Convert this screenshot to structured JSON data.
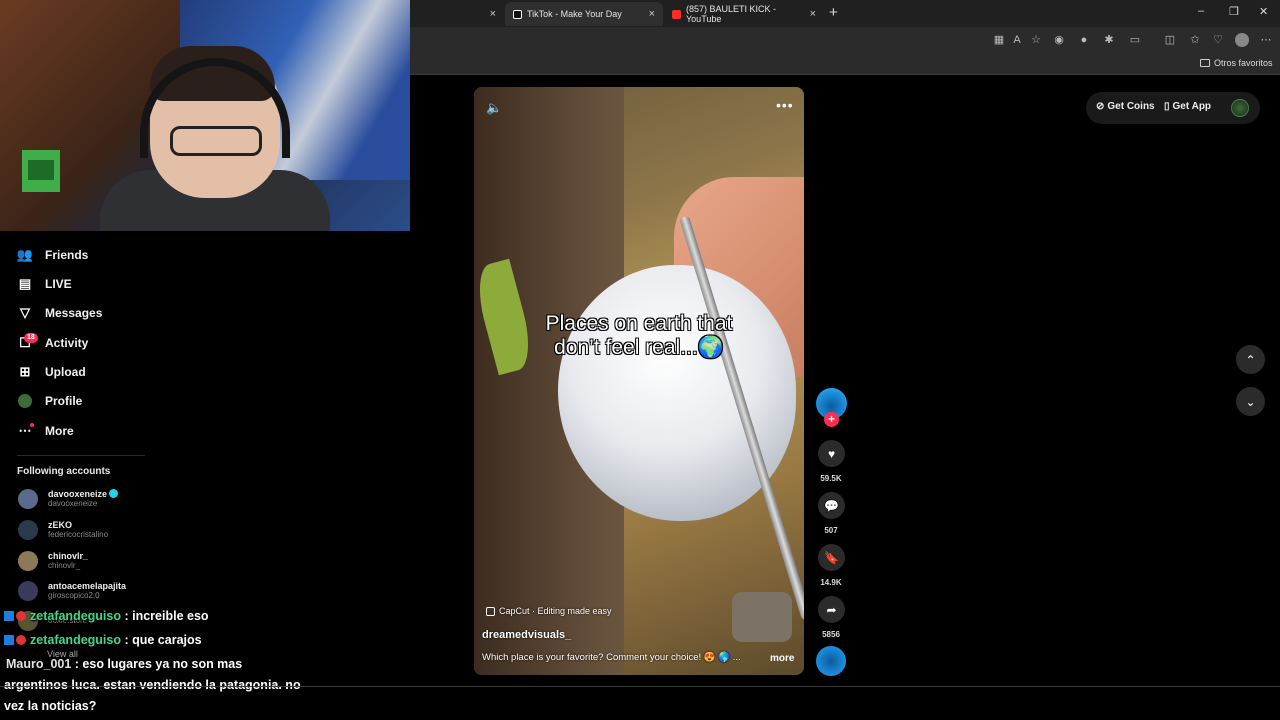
{
  "browser": {
    "tabs": [
      {
        "label": "",
        "close": "×"
      },
      {
        "label": "TikTok - Make Your Day",
        "close": "×"
      },
      {
        "label": "(857) BAULETI KICK - YouTube",
        "close": "×"
      }
    ],
    "new_tab": "+",
    "window_controls": {
      "minimize": "–",
      "maximize": "❐",
      "close": "✕"
    },
    "bookmarks_folder": "Otros favoritos"
  },
  "sidebar": {
    "items": [
      {
        "label": "Friends",
        "icon": "friends-icon"
      },
      {
        "label": "LIVE",
        "icon": "live-icon"
      },
      {
        "label": "Messages",
        "icon": "messages-icon"
      },
      {
        "label": "Activity",
        "icon": "activity-icon"
      },
      {
        "label": "Upload",
        "icon": "upload-icon"
      },
      {
        "label": "Profile",
        "icon": "profile-icon"
      },
      {
        "label": "More",
        "icon": "more-icon"
      }
    ],
    "activity_badge": "18",
    "following_title": "Following accounts",
    "accounts": [
      {
        "name": "davooxeneize",
        "username": "davooxeneize",
        "verified": true
      },
      {
        "name": "zEKO",
        "username": "federicocristalino"
      },
      {
        "name": "chinovlr_",
        "username": "chinovlr_"
      },
      {
        "name": "antoacemelapajita",
        "username": "giroscopico2.0"
      },
      {
        "name": "",
        "username": "ooxie.store"
      }
    ],
    "view_all": "View all"
  },
  "chat": [
    {
      "user": "zetafandeguiso",
      "message": " : increible eso"
    },
    {
      "user": "zetafandeguiso",
      "message": " : que carajos"
    },
    {
      "user": "Mauro_001",
      "message": " : eso lugares ya no son mas"
    },
    {
      "user": "",
      "message": "argentinos luca. estan vendiendo la patagonia. no"
    },
    {
      "user": "",
      "message": "vez la noticias?"
    }
  ],
  "video": {
    "overlay_text_line1": "Places on earth that",
    "overlay_text_line2": "don’t feel real...🌍",
    "capcut": "CapCut · Editing made easy",
    "author": "dreamedvisuals_",
    "description": "Which place is your favorite? Comment your choice! 😍 🌎 ...",
    "more": "more",
    "menu": "•••"
  },
  "actions": {
    "follow": "+",
    "likes": "59.5K",
    "comments": "507",
    "saves": "14.9K",
    "shares": "5856"
  },
  "topright": {
    "get_coins": "Get Coins",
    "get_app": "Get App"
  },
  "colors": {
    "accent": "#fe2c55",
    "chat_user": "#3fd98a",
    "verified": "#20d5ec"
  }
}
